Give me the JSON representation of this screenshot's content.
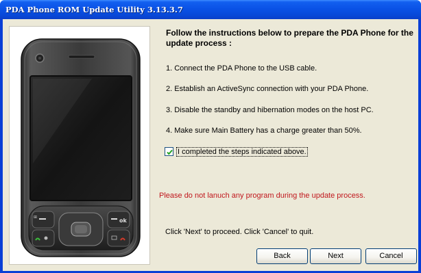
{
  "window": {
    "title": "PDA Phone ROM Update Utility 3.13.3.7"
  },
  "instructions": {
    "heading": "Follow the instructions below to prepare the PDA Phone for the update process :",
    "steps": [
      "1. Connect the PDA Phone to the USB cable.",
      "2. Establish an ActiveSync connection with your PDA Phone.",
      "3. Disable the standby and hibernation modes on the host PC.",
      "4. Make sure Main Battery has a charge greater than 50%."
    ]
  },
  "confirm": {
    "label": "I completed the steps indicated above.",
    "checked": true
  },
  "warning": {
    "text": "Please do not lanuch any program during the update process.",
    "color": "#c0161c"
  },
  "footer": {
    "hint": "Click 'Next' to proceed. Click 'Cancel' to quit."
  },
  "buttons": {
    "back": "Back",
    "next": "Next",
    "cancel": "Cancel"
  },
  "phone_keys": {
    "ok": "ok"
  },
  "colors": {
    "titlebar": "#0a52e6",
    "dialog_bg": "#ece9d8",
    "button_border": "#003c74"
  }
}
